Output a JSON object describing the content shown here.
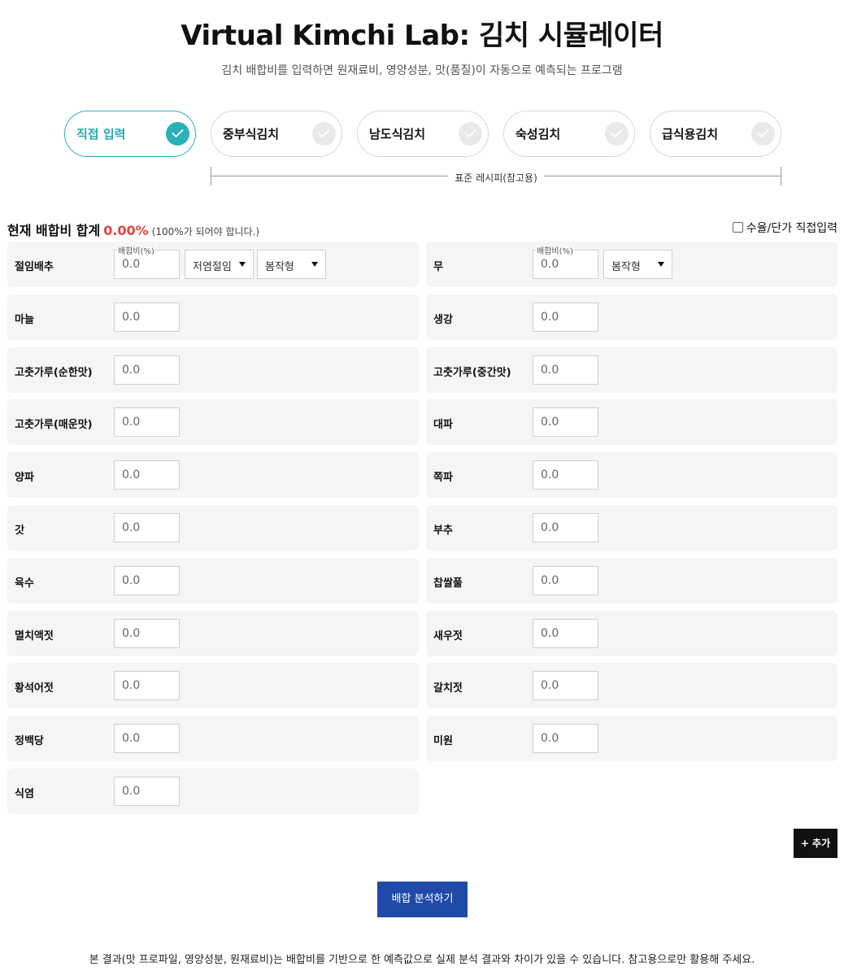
{
  "header": {
    "title": "Virtual Kimchi Lab: 김치 시뮬레이터",
    "subtitle": "김치 배합비를 입력하면 원재료비, 영양성분, 맛(품질)이 자동으로 예측되는 프로그램"
  },
  "presets": [
    {
      "label": "직접 입력",
      "active": true
    },
    {
      "label": "중부식김치",
      "active": false
    },
    {
      "label": "남도식김치",
      "active": false
    },
    {
      "label": "숙성김치",
      "active": false
    },
    {
      "label": "급식용김치",
      "active": false
    }
  ],
  "reference_label": "표준 레시피(참고용)",
  "summary": {
    "label": "현재 배합비 합계",
    "value": "0.00%",
    "hint": "(100%가 되어야 합니다.)",
    "manual_label": "수율/단가 직접입력",
    "manual_checked": false
  },
  "ratio_caption": "배합비(%)",
  "ingredients": [
    {
      "name": "절임배추",
      "value": "0.0",
      "selects": [
        "저염절임",
        "봄작형"
      ]
    },
    {
      "name": "무",
      "value": "0.0",
      "selects": [
        "봄작형"
      ]
    },
    {
      "name": "마늘",
      "value": "0.0"
    },
    {
      "name": "생강",
      "value": "0.0"
    },
    {
      "name": "고춧가루(순한맛)",
      "value": "0.0"
    },
    {
      "name": "고춧가루(중간맛)",
      "value": "0.0"
    },
    {
      "name": "고춧가루(매운맛)",
      "value": "0.0"
    },
    {
      "name": "대파",
      "value": "0.0"
    },
    {
      "name": "양파",
      "value": "0.0"
    },
    {
      "name": "쪽파",
      "value": "0.0"
    },
    {
      "name": "갓",
      "value": "0.0"
    },
    {
      "name": "부추",
      "value": "0.0"
    },
    {
      "name": "육수",
      "value": "0.0"
    },
    {
      "name": "찹쌀풀",
      "value": "0.0"
    },
    {
      "name": "멸치액젓",
      "value": "0.0"
    },
    {
      "name": "새우젓",
      "value": "0.0"
    },
    {
      "name": "황석어젓",
      "value": "0.0"
    },
    {
      "name": "갈치젓",
      "value": "0.0"
    },
    {
      "name": "정백당",
      "value": "0.0"
    },
    {
      "name": "미원",
      "value": "0.0"
    },
    {
      "name": "식염",
      "value": "0.0"
    }
  ],
  "buttons": {
    "add": "+ 추가",
    "analyze": "배합 분석하기"
  },
  "footer": "본 결과(맛 프로파일, 영양성분, 원재료비)는 배합비를 기반으로 한 예측값으로 실제 분석 결과와 차이가 있을 수 있습니다. 참고용으로만 활용해 주세요.",
  "colors": {
    "accent": "#2bb0b9",
    "sum_value": "#e0453e",
    "analyze_button": "#1f4aa8",
    "add_button": "#111111"
  }
}
